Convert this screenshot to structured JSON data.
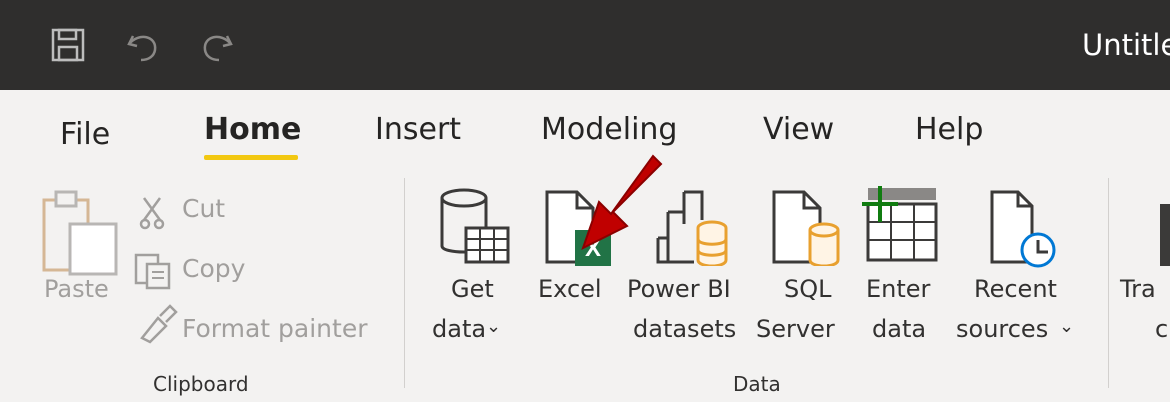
{
  "title_bar": {
    "app_title": "Untitle"
  },
  "tabs": [
    {
      "label": "File"
    },
    {
      "label": "Home"
    },
    {
      "label": "Insert"
    },
    {
      "label": "Modeling"
    },
    {
      "label": "View"
    },
    {
      "label": "Help"
    }
  ],
  "clipboard": {
    "paste": "Paste",
    "cut": "Cut",
    "copy": "Copy",
    "format_painter": "Format painter",
    "group_label": "Clipboard"
  },
  "data": {
    "get_data": [
      "Get",
      "data"
    ],
    "excel": "Excel",
    "power_bi": [
      "Power BI",
      "datasets"
    ],
    "sql": [
      "SQL",
      "Server"
    ],
    "enter": [
      "Enter",
      "data"
    ],
    "recent": [
      "Recent",
      "sources"
    ],
    "group_label": "Data"
  },
  "transform": [
    "Tra",
    "c"
  ],
  "colors": {
    "accent": "#f2c811",
    "excel_green": "#217346",
    "arrow_red": "#c00000"
  },
  "icons": [
    "save-icon",
    "undo-icon",
    "redo-icon",
    "paste-icon",
    "cut-icon",
    "copy-icon",
    "format-painter-icon",
    "get-data-icon",
    "excel-icon",
    "power-bi-datasets-icon",
    "sql-server-icon",
    "enter-data-icon",
    "recent-sources-icon",
    "red-arrow-icon"
  ]
}
